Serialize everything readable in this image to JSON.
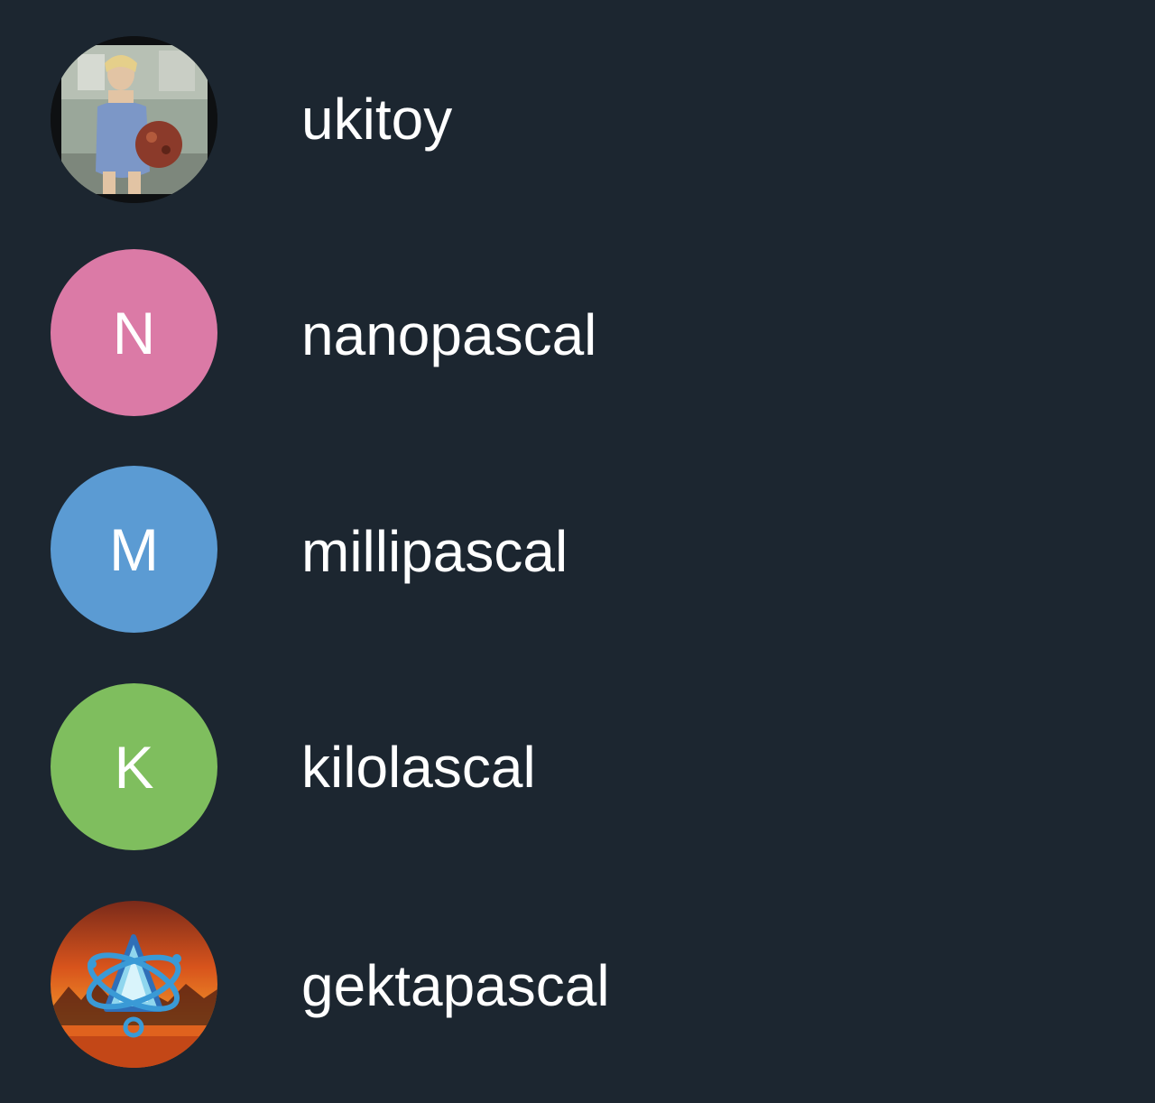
{
  "contacts": [
    {
      "name": "ukitoy",
      "avatar_type": "photo",
      "avatar_icon": "user-photo-icon"
    },
    {
      "name": "nanopascal",
      "avatar_type": "initial",
      "initial": "N",
      "color": "#db7aa6"
    },
    {
      "name": "millipascal",
      "avatar_type": "initial",
      "initial": "M",
      "color": "#5b9bd3"
    },
    {
      "name": "kilolascal",
      "avatar_type": "initial",
      "initial": "K",
      "color": "#7fbe5e"
    },
    {
      "name": "gektapascal",
      "avatar_type": "photo",
      "avatar_icon": "emblem-photo-icon"
    }
  ]
}
